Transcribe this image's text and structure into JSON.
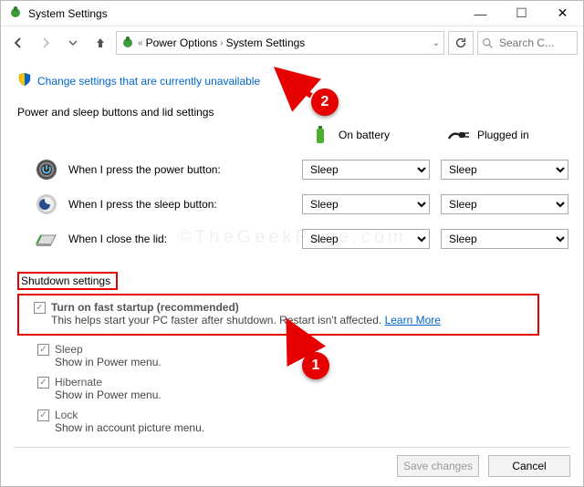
{
  "window": {
    "title": "System Settings"
  },
  "breadcrumb": {
    "level1": "Power Options",
    "level2": "System Settings"
  },
  "search": {
    "placeholder": "Search C..."
  },
  "change_link": "Change settings that are currently unavailable",
  "section_header": "Power and sleep buttons and lid settings",
  "col_battery": "On battery",
  "col_plugged": "Plugged in",
  "rows": {
    "power": {
      "label": "When I press the power button:",
      "battery": "Sleep",
      "plugged": "Sleep"
    },
    "sleep": {
      "label": "When I press the sleep button:",
      "battery": "Sleep",
      "plugged": "Sleep"
    },
    "lid": {
      "label": "When I close the lid:",
      "battery": "Sleep",
      "plugged": "Sleep"
    }
  },
  "shutdown_header": "Shutdown settings",
  "shutdown": {
    "fast": {
      "title": "Turn on fast startup (recommended)",
      "desc_a": "This helps start your PC faster after shutdown. Restart isn't affected. ",
      "learn": "Learn More"
    },
    "sleep": {
      "title": "Sleep",
      "desc": "Show in Power menu."
    },
    "hibernate": {
      "title": "Hibernate",
      "desc": "Show in Power menu."
    },
    "lock": {
      "title": "Lock",
      "desc": "Show in account picture menu."
    }
  },
  "buttons": {
    "save": "Save changes",
    "cancel": "Cancel"
  },
  "annotations": {
    "one": "1",
    "two": "2"
  },
  "watermark": "©TheGeekPage.com"
}
